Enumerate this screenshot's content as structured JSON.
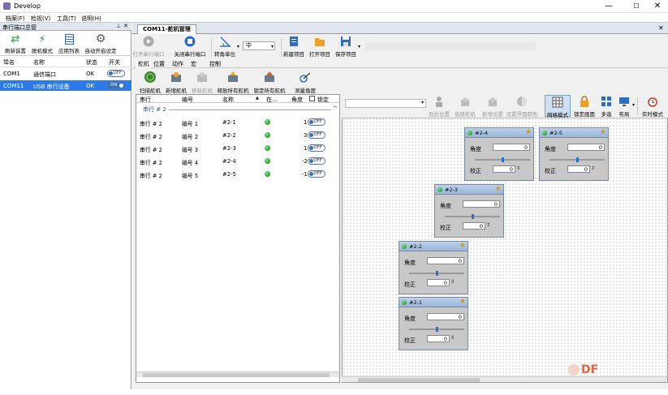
{
  "window": {
    "title": "Develop",
    "min": "—",
    "max": "☐",
    "close": "✕"
  },
  "menu": [
    "档案(F)",
    "检视(V)",
    "工具(T)",
    "说明(H)"
  ],
  "left_panel": {
    "title": "串行端口总管",
    "pin": "⊥",
    "close": "✕",
    "toolbar": [
      "刷新装置",
      "脱机模式",
      "应用列表",
      "自动开启设定"
    ],
    "columns": [
      "埠名",
      "名称",
      "状态",
      "开关"
    ],
    "rows": [
      {
        "port": "COM1",
        "name": "通信端口",
        "status": "OK",
        "switch": "OFF"
      },
      {
        "port": "COM11",
        "name": "USB 串行设备",
        "status": "OK",
        "switch": "ON"
      }
    ]
  },
  "main": {
    "tab": "COM11-舵机管理",
    "tab_close": "✕",
    "toolbar": [
      {
        "label": "打开串行端口",
        "disabled": true
      },
      {
        "label": "关闭串行端口",
        "disabled": false
      },
      {
        "label": "转角单位",
        "disabled": false
      },
      {
        "label": "新建项目",
        "disabled": false
      },
      {
        "label": "打开项目",
        "disabled": false
      },
      {
        "label": "保存项目",
        "disabled": false
      }
    ],
    "unit_value": "中",
    "subtabs": [
      "舵机",
      "位置",
      "动作",
      "宏",
      "控制"
    ],
    "commands": [
      {
        "label": "扫描舵机",
        "disabled": false
      },
      {
        "label": "新增舵机",
        "disabled": false
      },
      {
        "label": "移除舵机",
        "disabled": true
      },
      {
        "label": "释放所有舵机",
        "disabled": false
      },
      {
        "label": "锁定所有舵机",
        "disabled": false
      },
      {
        "label": "测量角度",
        "disabled": false
      }
    ],
    "list_columns": [
      "串行",
      "编号",
      "名称",
      "在...",
      "角度",
      "锁定"
    ],
    "sort_arrow": "▲",
    "group_label": "串行 # 2",
    "collapse_arrow": "^",
    "list_rows": [
      {
        "serial": "串行 # 2",
        "num": "编号 1",
        "name": "#2-1",
        "angle": "1",
        "lock": "OFF"
      },
      {
        "serial": "串行 # 2",
        "num": "编号 2",
        "name": "#2-2",
        "angle": "3",
        "lock": "OFF"
      },
      {
        "serial": "串行 # 2",
        "num": "编号 3",
        "name": "#2-3",
        "angle": "1",
        "lock": "OFF"
      },
      {
        "serial": "串行 # 2",
        "num": "编号 4",
        "name": "#2-4",
        "angle": "-2",
        "lock": "OFF"
      },
      {
        "serial": "串行 # 2",
        "num": "编号 5",
        "name": "#2-5",
        "angle": "-1",
        "lock": "OFF"
      }
    ],
    "canvas_toolbar": [
      {
        "label": "到此位置",
        "disabled": true
      },
      {
        "label": "选择舵机",
        "disabled": true
      },
      {
        "label": "新增位置",
        "disabled": true
      },
      {
        "label": "设置界面颜色",
        "disabled": true
      },
      {
        "label": "网格模式",
        "disabled": false
      },
      {
        "label": "锁定画面",
        "disabled": false
      },
      {
        "label": "多选",
        "disabled": false
      },
      {
        "label": "布局",
        "disabled": false
      },
      {
        "label": "实时模式",
        "disabled": false
      }
    ],
    "servo_cards": [
      {
        "name": "#2-4",
        "angle_label": "角度",
        "angle": "0",
        "trim_label": "校正",
        "trim": "0",
        "slider_pct": 0.48
      },
      {
        "name": "#2-5",
        "angle_label": "角度",
        "angle": "0",
        "trim_label": "校正",
        "trim": "0",
        "slider_pct": 0.48
      },
      {
        "name": "#2-3",
        "angle_label": "角度",
        "angle": "0",
        "trim_label": "校正",
        "trim": "0",
        "slider_pct": 0.48
      },
      {
        "name": "#2-2",
        "angle_label": "角度",
        "angle": "0",
        "trim_label": "校正",
        "trim": "0",
        "slider_pct": 0.48
      },
      {
        "name": "#2-1",
        "angle_label": "角度",
        "angle": "0",
        "trim_label": "校正",
        "trim": "0",
        "slider_pct": 0.48
      }
    ]
  },
  "watermark": "DF",
  "colors": {
    "selected": "#2e7be8",
    "tab_bg": "#dfe6ef",
    "card_header": "#9ab6d9",
    "led": "#1ea81e",
    "star": "#d19a14"
  }
}
